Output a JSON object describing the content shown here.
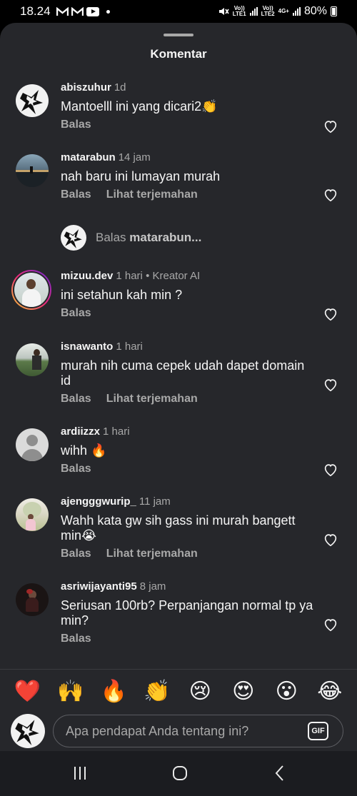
{
  "status_bar": {
    "time": "18.24",
    "left_icons": [
      "gmail-icon",
      "gmail-icon",
      "youtube-icon",
      "dot-icon"
    ],
    "sim1_label": "Vo)) LTE1",
    "sim2_label": "Vo)) LTE2",
    "net_label": "4G+",
    "battery": "80%"
  },
  "sheet": {
    "title": "Komentar"
  },
  "comments": [
    {
      "username": "abiszuhur",
      "time": "1d",
      "extra": "",
      "text": "Mantoelll ini yang dicari2👏",
      "reply": "Balas",
      "translate": ""
    },
    {
      "username": "matarabun",
      "time": "14 jam",
      "extra": "",
      "text": "nah baru ini lumayan murah",
      "reply": "Balas",
      "translate": "Lihat terjemahan"
    },
    {
      "username": "mizuu.dev",
      "time": "1 hari",
      "extra": "• Kreator AI",
      "text": "ini setahun kah min ?",
      "reply": "Balas",
      "translate": ""
    },
    {
      "username": "isnawanto",
      "time": "1 hari",
      "extra": "",
      "text": "murah nih cuma cepek udah dapet domain id",
      "reply": "Balas",
      "translate": "Lihat terjemahan"
    },
    {
      "username": "ardiizzx",
      "time": "1 hari",
      "extra": "",
      "text": "wihh 🔥",
      "reply": "Balas",
      "translate": ""
    },
    {
      "username": "ajengggwurip_",
      "time": "11 jam",
      "extra": "",
      "text": "Wahh kata gw sih gass ini murah bangett min😭",
      "reply": "Balas",
      "translate": "Lihat terjemahan"
    },
    {
      "username": "asriwijayanti95",
      "time": "8 jam",
      "extra": "",
      "text": "Seriusan 100rb? Perpanjangan normal tp ya min?",
      "reply": "Balas",
      "translate": ""
    }
  ],
  "reply_prompt": {
    "prefix": "Balas",
    "username": "matarabun..."
  },
  "emoji_bar": [
    "❤️",
    "🙌",
    "🔥",
    "👏",
    "😢",
    "😍",
    "😮",
    "😂"
  ],
  "input": {
    "placeholder": "Apa pendapat Anda tentang ini?",
    "gif_label": "GIF"
  },
  "navbar": {
    "buttons": [
      "recent-apps-icon",
      "home-icon",
      "back-icon"
    ]
  },
  "colors": {
    "sheet_bg": "#26272b",
    "text_primary": "#f5f5f5",
    "text_secondary": "#a8a8a8"
  }
}
